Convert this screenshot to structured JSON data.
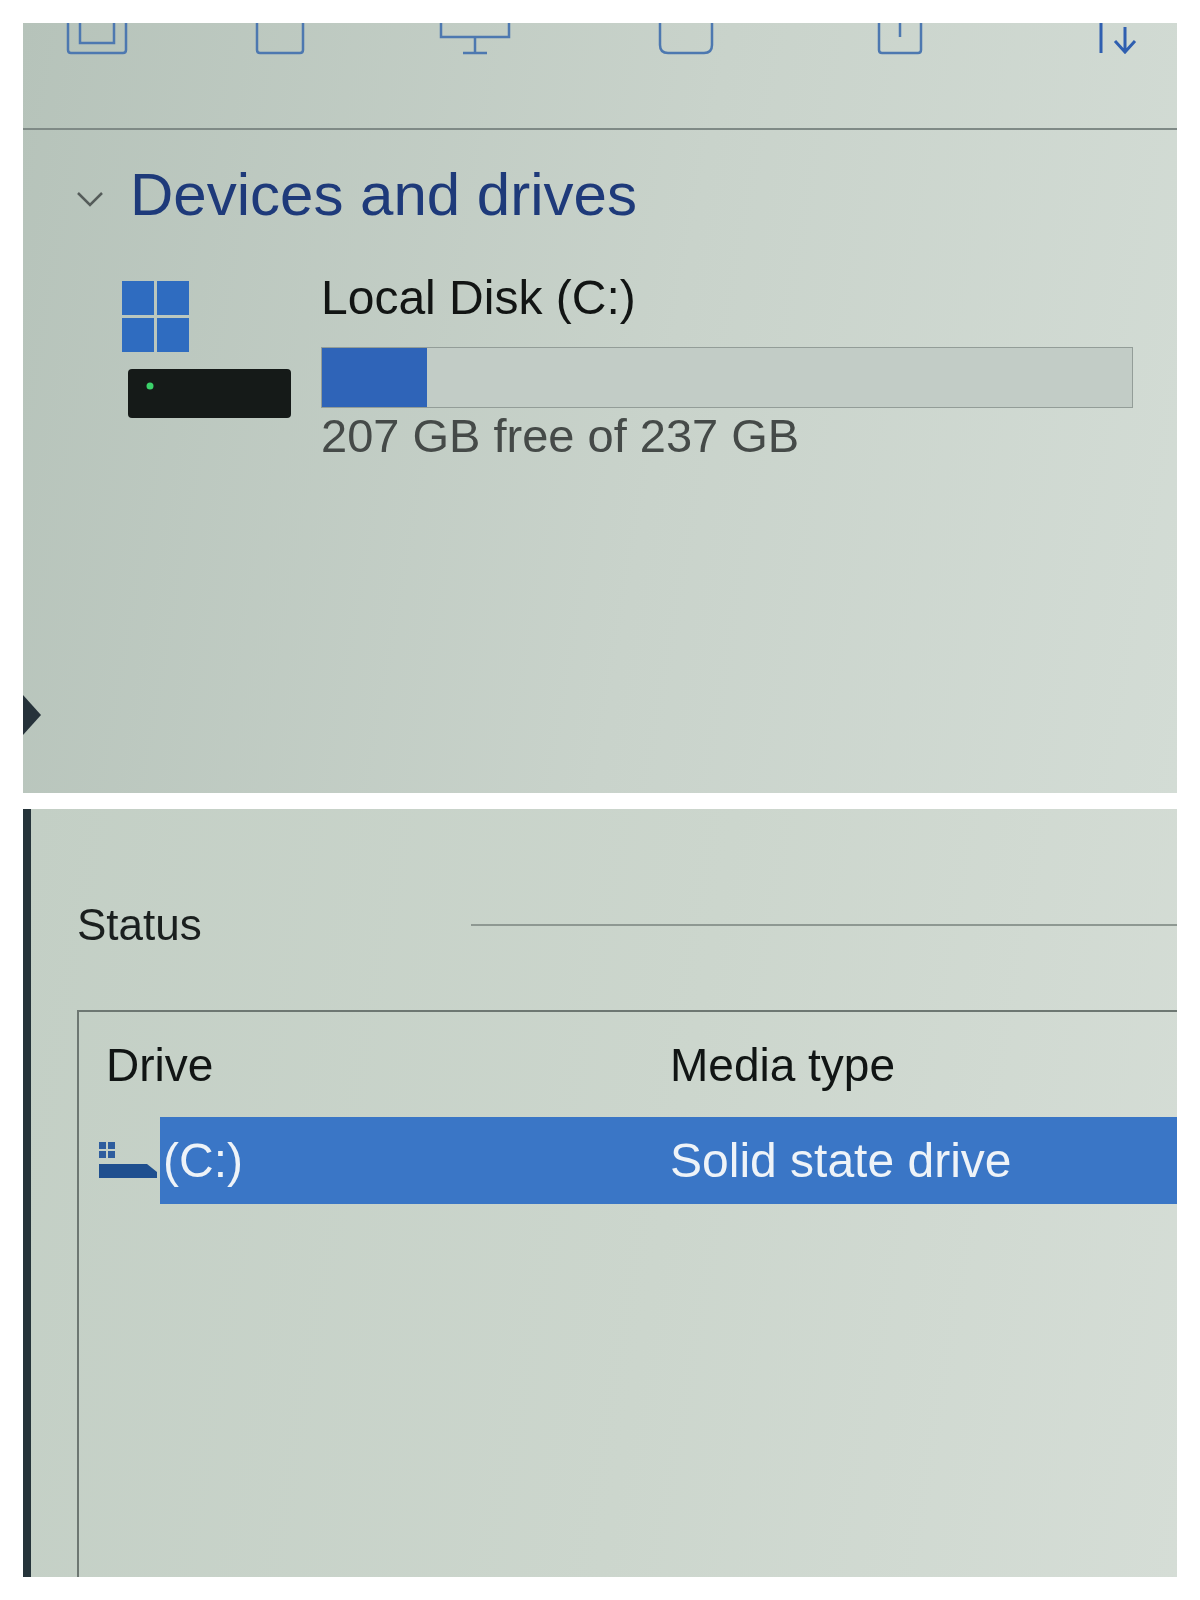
{
  "section": {
    "title": "Devices and drives",
    "expanded": true
  },
  "drives": [
    {
      "name": "Local Disk (C:)",
      "level": 0.13,
      "free_text": "207 GB free of 237 GB"
    }
  ],
  "status": {
    "title": "Status",
    "table": {
      "columns": [
        "Drive",
        "Media type"
      ],
      "rows": [
        {
          "cells": [
            "(C:)",
            "Solid state drive"
          ],
          "selected": true
        }
      ]
    }
  }
}
